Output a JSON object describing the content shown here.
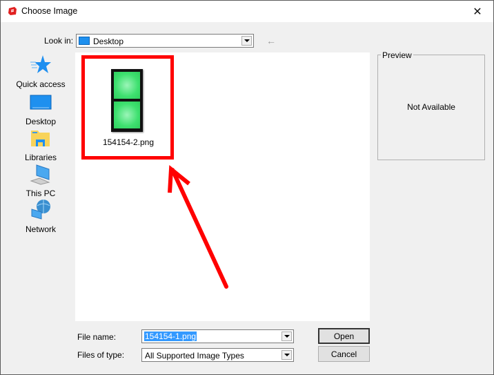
{
  "window": {
    "title": "Choose Image",
    "close_label": "✕"
  },
  "lookin": {
    "label": "Look in:",
    "value": "Desktop",
    "back_icon": "←"
  },
  "places": [
    {
      "label": "Quick access",
      "icon": "star-icon"
    },
    {
      "label": "Desktop",
      "icon": "desktop-icon"
    },
    {
      "label": "Libraries",
      "icon": "libraries-icon"
    },
    {
      "label": "This PC",
      "icon": "computer-icon"
    },
    {
      "label": "Network",
      "icon": "network-icon"
    }
  ],
  "files": [
    {
      "name": "154154-2.png"
    }
  ],
  "preview": {
    "legend": "Preview",
    "text": "Not Available"
  },
  "form": {
    "file_name_label": "File name:",
    "file_name_value": "154154-1.png",
    "file_type_label": "Files of type:",
    "file_type_value": "All Supported Image Types"
  },
  "buttons": {
    "open": "Open",
    "cancel": "Cancel"
  },
  "annotation": {
    "color": "#ff0000"
  }
}
